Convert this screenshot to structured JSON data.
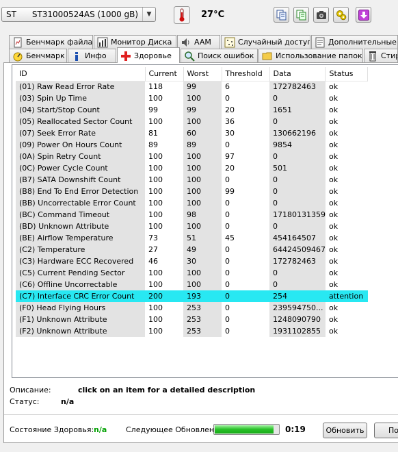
{
  "toolbar": {
    "drive_model": "ST      ST31000524AS (1000 gB)",
    "temperature": "27°C"
  },
  "tabs_top": [
    {
      "label": "Бенчмарк файла",
      "icon": "file-benchmark-icon"
    },
    {
      "label": "Монитор Диска",
      "icon": "disk-monitor-icon"
    },
    {
      "label": "AAM",
      "icon": "speaker-icon"
    },
    {
      "label": "Случайный доступ",
      "icon": "random-access-icon"
    },
    {
      "label": "Дополнительные тесты",
      "icon": "extra-tests-icon"
    }
  ],
  "tabs_bottom": [
    {
      "label": "Бенчмарк",
      "icon": "benchmark-icon"
    },
    {
      "label": "Инфо",
      "icon": "info-icon"
    },
    {
      "label": "Здоровье",
      "icon": "health-cross-icon"
    },
    {
      "label": "Поиск ошибок",
      "icon": "search-icon"
    },
    {
      "label": "Использование папок",
      "icon": "folder-icon"
    },
    {
      "label": "Стир",
      "icon": "erase-icon"
    }
  ],
  "table": {
    "columns": [
      "ID",
      "Current",
      "Worst",
      "Threshold",
      "Data",
      "Status"
    ],
    "rows": [
      [
        "(01) Raw Read Error Rate",
        "118",
        "99",
        "6",
        "172782463",
        "ok"
      ],
      [
        "(03) Spin Up Time",
        "100",
        "100",
        "0",
        "0",
        "ok"
      ],
      [
        "(04) Start/Stop Count",
        "99",
        "99",
        "20",
        "1651",
        "ok"
      ],
      [
        "(05) Reallocated Sector Count",
        "100",
        "100",
        "36",
        "0",
        "ok"
      ],
      [
        "(07) Seek Error Rate",
        "81",
        "60",
        "30",
        "130662196",
        "ok"
      ],
      [
        "(09) Power On Hours Count",
        "89",
        "89",
        "0",
        "9854",
        "ok"
      ],
      [
        "(0A) Spin Retry Count",
        "100",
        "100",
        "97",
        "0",
        "ok"
      ],
      [
        "(0C) Power Cycle Count",
        "100",
        "100",
        "20",
        "501",
        "ok"
      ],
      [
        "(B7) SATA Downshift Count",
        "100",
        "100",
        "0",
        "0",
        "ok"
      ],
      [
        "(B8) End To End Error Detection",
        "100",
        "100",
        "99",
        "0",
        "ok"
      ],
      [
        "(BB) Uncorrectable Error Count",
        "100",
        "100",
        "0",
        "0",
        "ok"
      ],
      [
        "(BC) Command Timeout",
        "100",
        "98",
        "0",
        "17180131359",
        "ok"
      ],
      [
        "(BD) Unknown Attribute",
        "100",
        "100",
        "0",
        "0",
        "ok"
      ],
      [
        "(BE) Airflow Temperature",
        "73",
        "51",
        "45",
        "454164507",
        "ok"
      ],
      [
        "(C2) Temperature",
        "27",
        "49",
        "0",
        "64424509467",
        "ok"
      ],
      [
        "(C3) Hardware ECC Recovered",
        "46",
        "30",
        "0",
        "172782463",
        "ok"
      ],
      [
        "(C5) Current Pending Sector",
        "100",
        "100",
        "0",
        "0",
        "ok"
      ],
      [
        "(C6) Offline Uncorrectable",
        "100",
        "100",
        "0",
        "0",
        "ok"
      ],
      [
        "(C7) Interface CRC Error Count",
        "200",
        "193",
        "0",
        "254",
        "attention"
      ],
      [
        "(F0) Head Flying Hours",
        "100",
        "253",
        "0",
        "239594750...",
        "ok"
      ],
      [
        "(F1) Unknown Attribute",
        "100",
        "253",
        "0",
        "1248090790",
        "ok"
      ],
      [
        "(F2) Unknown Attribute",
        "100",
        "253",
        "0",
        "1931102855",
        "ok"
      ]
    ],
    "highlight_row": 18,
    "highlight_color": "#28e8f2"
  },
  "details": {
    "description_label": "Описание:",
    "description_text": "click on an item for a detailed description",
    "status_label": "Статус:",
    "status_value": "n/a"
  },
  "footer": {
    "health_label": "Состояние Здоровья:",
    "health_value": "n/a",
    "next_update_label": "Следующее Обновление:",
    "update_progress": 0.93,
    "timer": "0:19",
    "refresh_button": "Обновить",
    "next_button": "По"
  },
  "colors": {
    "accent_green": "#00a000",
    "selection": "#28e8f2"
  }
}
